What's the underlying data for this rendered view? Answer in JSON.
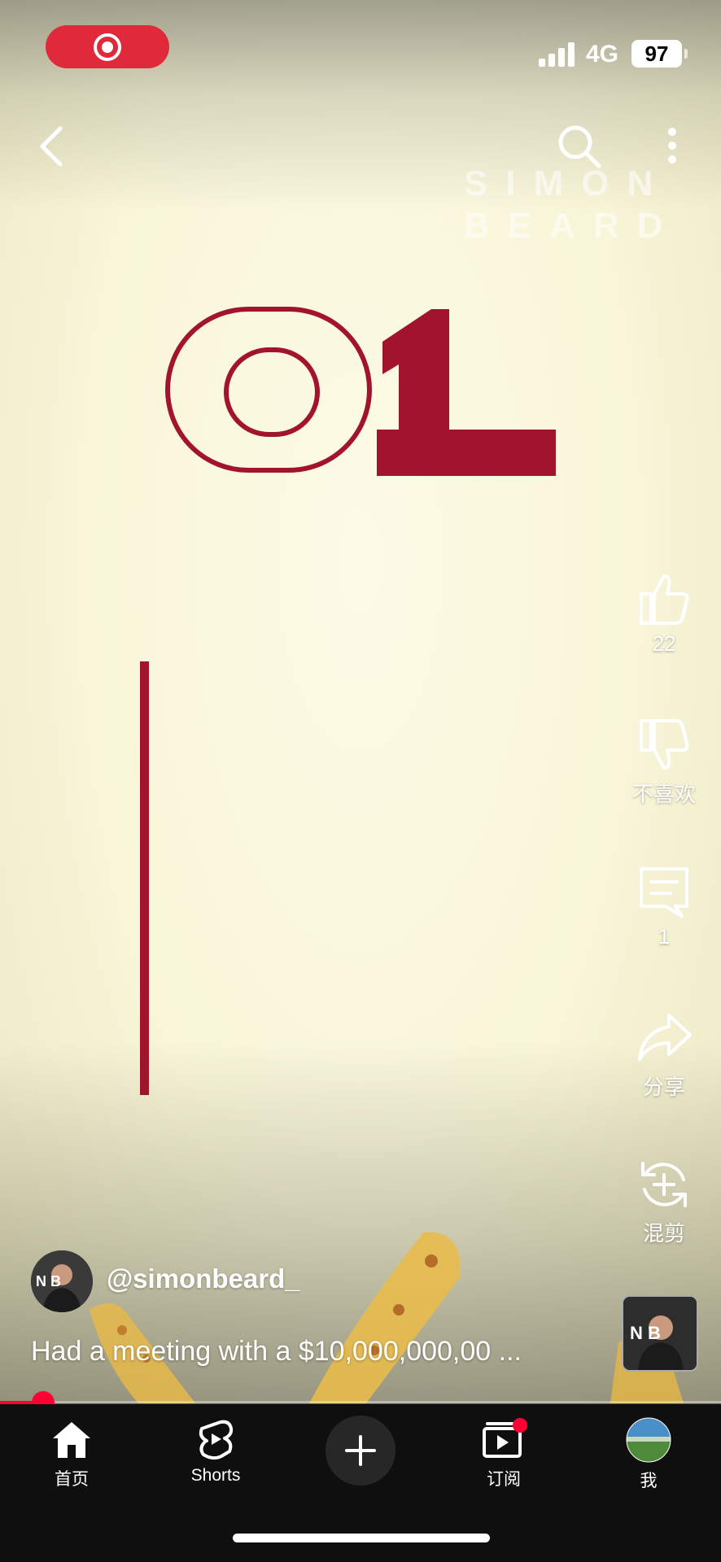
{
  "status_bar": {
    "network": "4G",
    "battery": "97"
  },
  "video": {
    "watermark_line1": "SIMON",
    "watermark_line2": "BEARD",
    "big_number": "01",
    "accent_color": "#a2132d"
  },
  "actions": {
    "like_count": "22",
    "dislike_label": "不喜欢",
    "comment_count": "1",
    "share_label": "分享",
    "remix_label": "混剪"
  },
  "channel": {
    "handle": "@simonbeard_",
    "avatar_text": "N B",
    "caption": "Had a meeting with a $10,000,000,00 ..."
  },
  "thumb_text": "N B",
  "progress": {
    "played_fraction": 0.06
  },
  "nav": {
    "home": "首页",
    "shorts": "Shorts",
    "subscriptions": "订阅",
    "me": "我",
    "create_icon": "plus-icon"
  },
  "colors": {
    "brand_red": "#ff0033",
    "nav_bg": "#0f0f0f"
  }
}
